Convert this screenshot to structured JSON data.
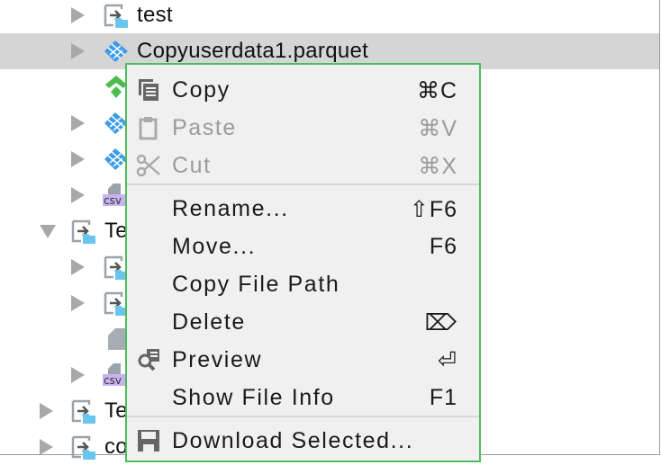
{
  "tree": {
    "items": [
      {
        "label": "test",
        "icon": "module-folder-icon",
        "expander": "collapsed"
      },
      {
        "label": "Copyuserdata1.parquet",
        "icon": "parquet-file-icon",
        "expander": "collapsed",
        "selected": true
      },
      {
        "label": "",
        "icon": "green-file-icon",
        "expander": "none"
      },
      {
        "label": "",
        "icon": "parquet-file-icon",
        "expander": "collapsed"
      },
      {
        "label": "",
        "icon": "parquet-file-icon",
        "expander": "collapsed"
      },
      {
        "label": "",
        "icon": "csv-file-icon",
        "expander": "collapsed"
      },
      {
        "label": "Te",
        "icon": "module-folder-icon",
        "expander": "expanded"
      },
      {
        "label": "",
        "icon": "module-folder-icon",
        "expander": "collapsed"
      },
      {
        "label": "",
        "icon": "module-folder-icon",
        "expander": "collapsed"
      },
      {
        "label": "",
        "icon": "file-icon",
        "expander": "none"
      },
      {
        "label": "",
        "icon": "csv-file-icon",
        "expander": "collapsed"
      },
      {
        "label": "Te",
        "icon": "module-folder-icon",
        "expander": "collapsed"
      },
      {
        "label": "co",
        "icon": "module-folder-icon",
        "expander": "collapsed"
      }
    ],
    "csv_badge": "csv"
  },
  "menu": {
    "items": [
      {
        "label": "Copy",
        "shortcut": "⌘C",
        "icon": "copy-icon",
        "enabled": true
      },
      {
        "label": "Paste",
        "shortcut": "⌘V",
        "icon": "paste-icon",
        "enabled": false
      },
      {
        "label": "Cut",
        "shortcut": "⌘X",
        "icon": "cut-icon",
        "enabled": false
      },
      {
        "label": "Rename...",
        "shortcut": "⇧F6",
        "enabled": true
      },
      {
        "label": "Move...",
        "shortcut": "F6",
        "enabled": true
      },
      {
        "label": "Copy File Path",
        "shortcut": "",
        "enabled": true
      },
      {
        "label": "Delete",
        "shortcut": "⌦",
        "enabled": true
      },
      {
        "label": "Preview",
        "shortcut": "⏎",
        "icon": "preview-icon",
        "enabled": true
      },
      {
        "label": "Show File Info",
        "shortcut": "F1",
        "enabled": true
      },
      {
        "label": "Download Selected...",
        "shortcut": "",
        "icon": "save-icon",
        "enabled": true
      }
    ]
  },
  "colors": {
    "menu_border": "#4cbd5c",
    "selection": "#d5d5d5",
    "parquet": "#3d9be9",
    "csv_badge": "#c9b3ef"
  }
}
